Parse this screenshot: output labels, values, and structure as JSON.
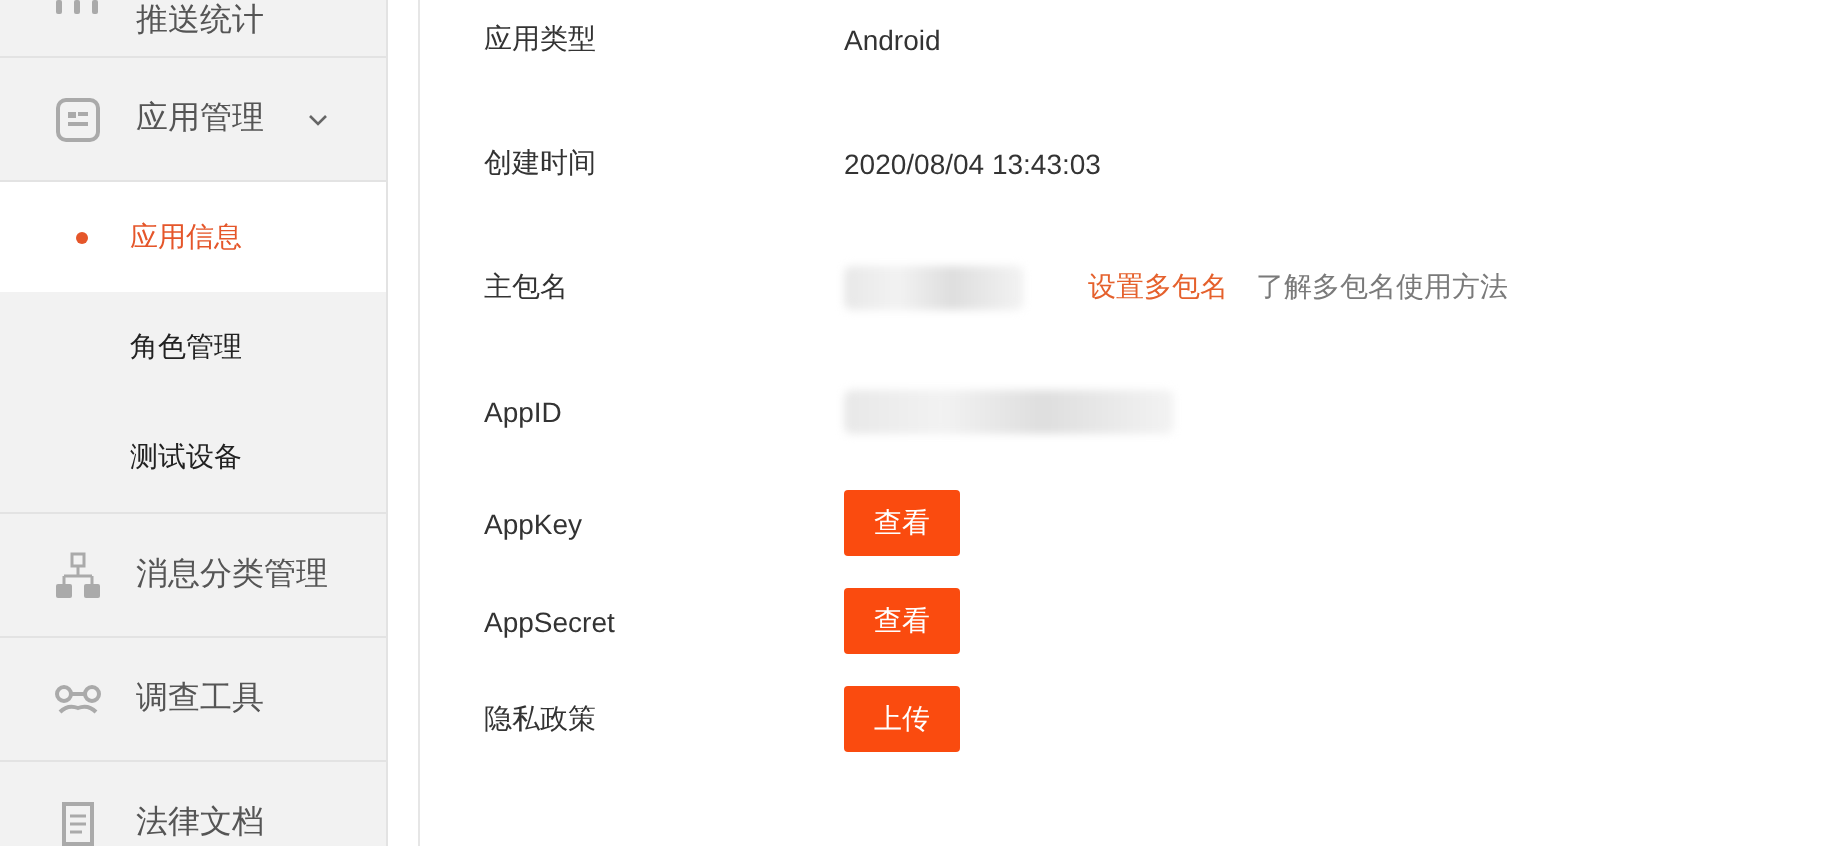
{
  "sidebar": {
    "items": [
      {
        "label": "推送统计"
      },
      {
        "label": "应用管理",
        "expanded": true,
        "children": [
          {
            "label": "应用信息",
            "selected": true
          },
          {
            "label": "角色管理",
            "selected": false
          },
          {
            "label": "测试设备",
            "selected": false
          }
        ]
      },
      {
        "label": "消息分类管理"
      },
      {
        "label": "调查工具"
      },
      {
        "label": "法律文档"
      }
    ]
  },
  "details": [
    {
      "kind": "text",
      "label": "应用类型",
      "value": "Android"
    },
    {
      "kind": "text",
      "label": "创建时间",
      "value": "2020/08/04 13:43:03"
    },
    {
      "kind": "redacted",
      "label": "主包名",
      "links": [
        {
          "text": "设置多包名",
          "kind": "accent"
        },
        {
          "text": "了解多包名使用方法",
          "kind": "muted"
        }
      ]
    },
    {
      "kind": "redacted",
      "label": "AppID"
    },
    {
      "kind": "button",
      "label": "AppKey",
      "button": "查看"
    },
    {
      "kind": "button",
      "label": "AppSecret",
      "button": "查看"
    },
    {
      "kind": "button",
      "label": "隐私政策",
      "button": "上传"
    }
  ]
}
